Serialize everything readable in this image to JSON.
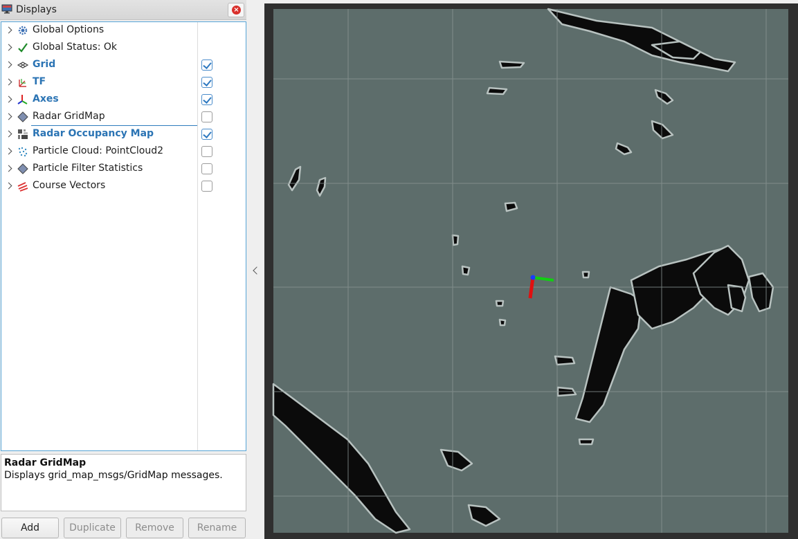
{
  "panel": {
    "title": "Displays",
    "icons": {
      "title": "monitor-icon",
      "close": "close-icon"
    }
  },
  "tree": {
    "items": [
      {
        "label": "Global Options",
        "icon": "gear-icon",
        "checkbox": null,
        "active": false
      },
      {
        "label": "Global Status: Ok",
        "icon": "checkmark-icon",
        "checkbox": null,
        "active": false
      },
      {
        "label": "Grid",
        "icon": "grid-icon",
        "checkbox": true,
        "active": true
      },
      {
        "label": "TF",
        "icon": "tf-frames-icon",
        "checkbox": true,
        "active": true
      },
      {
        "label": "Axes",
        "icon": "axes-icon",
        "checkbox": true,
        "active": true
      },
      {
        "label": "Radar GridMap",
        "icon": "diamond-icon",
        "checkbox": false,
        "active": false,
        "selected": true
      },
      {
        "label": "Radar Occupancy Map",
        "icon": "occupancy-map-icon",
        "checkbox": true,
        "active": true
      },
      {
        "label": "Particle Cloud: PointCloud2",
        "icon": "point-cloud-icon",
        "checkbox": false,
        "active": false
      },
      {
        "label": "Particle Filter Statistics",
        "icon": "diamond-icon",
        "checkbox": false,
        "active": false
      },
      {
        "label": "Course Vectors",
        "icon": "vectors-icon",
        "checkbox": false,
        "active": false
      }
    ]
  },
  "description": {
    "title": "Radar GridMap",
    "text": "Displays grid_map_msgs/GridMap messages."
  },
  "buttons": {
    "add": "Add",
    "duplicate": "Duplicate",
    "remove": "Remove",
    "rename": "Rename"
  },
  "viewport": {
    "icons": {
      "collapse": "chevron-left-icon"
    },
    "colors": {
      "background": "#2f2f2f",
      "map": "#5d6d6b",
      "obstacle": "#0b0b0b",
      "edge": "#b8c2c0",
      "grid": "#8a9694"
    }
  }
}
